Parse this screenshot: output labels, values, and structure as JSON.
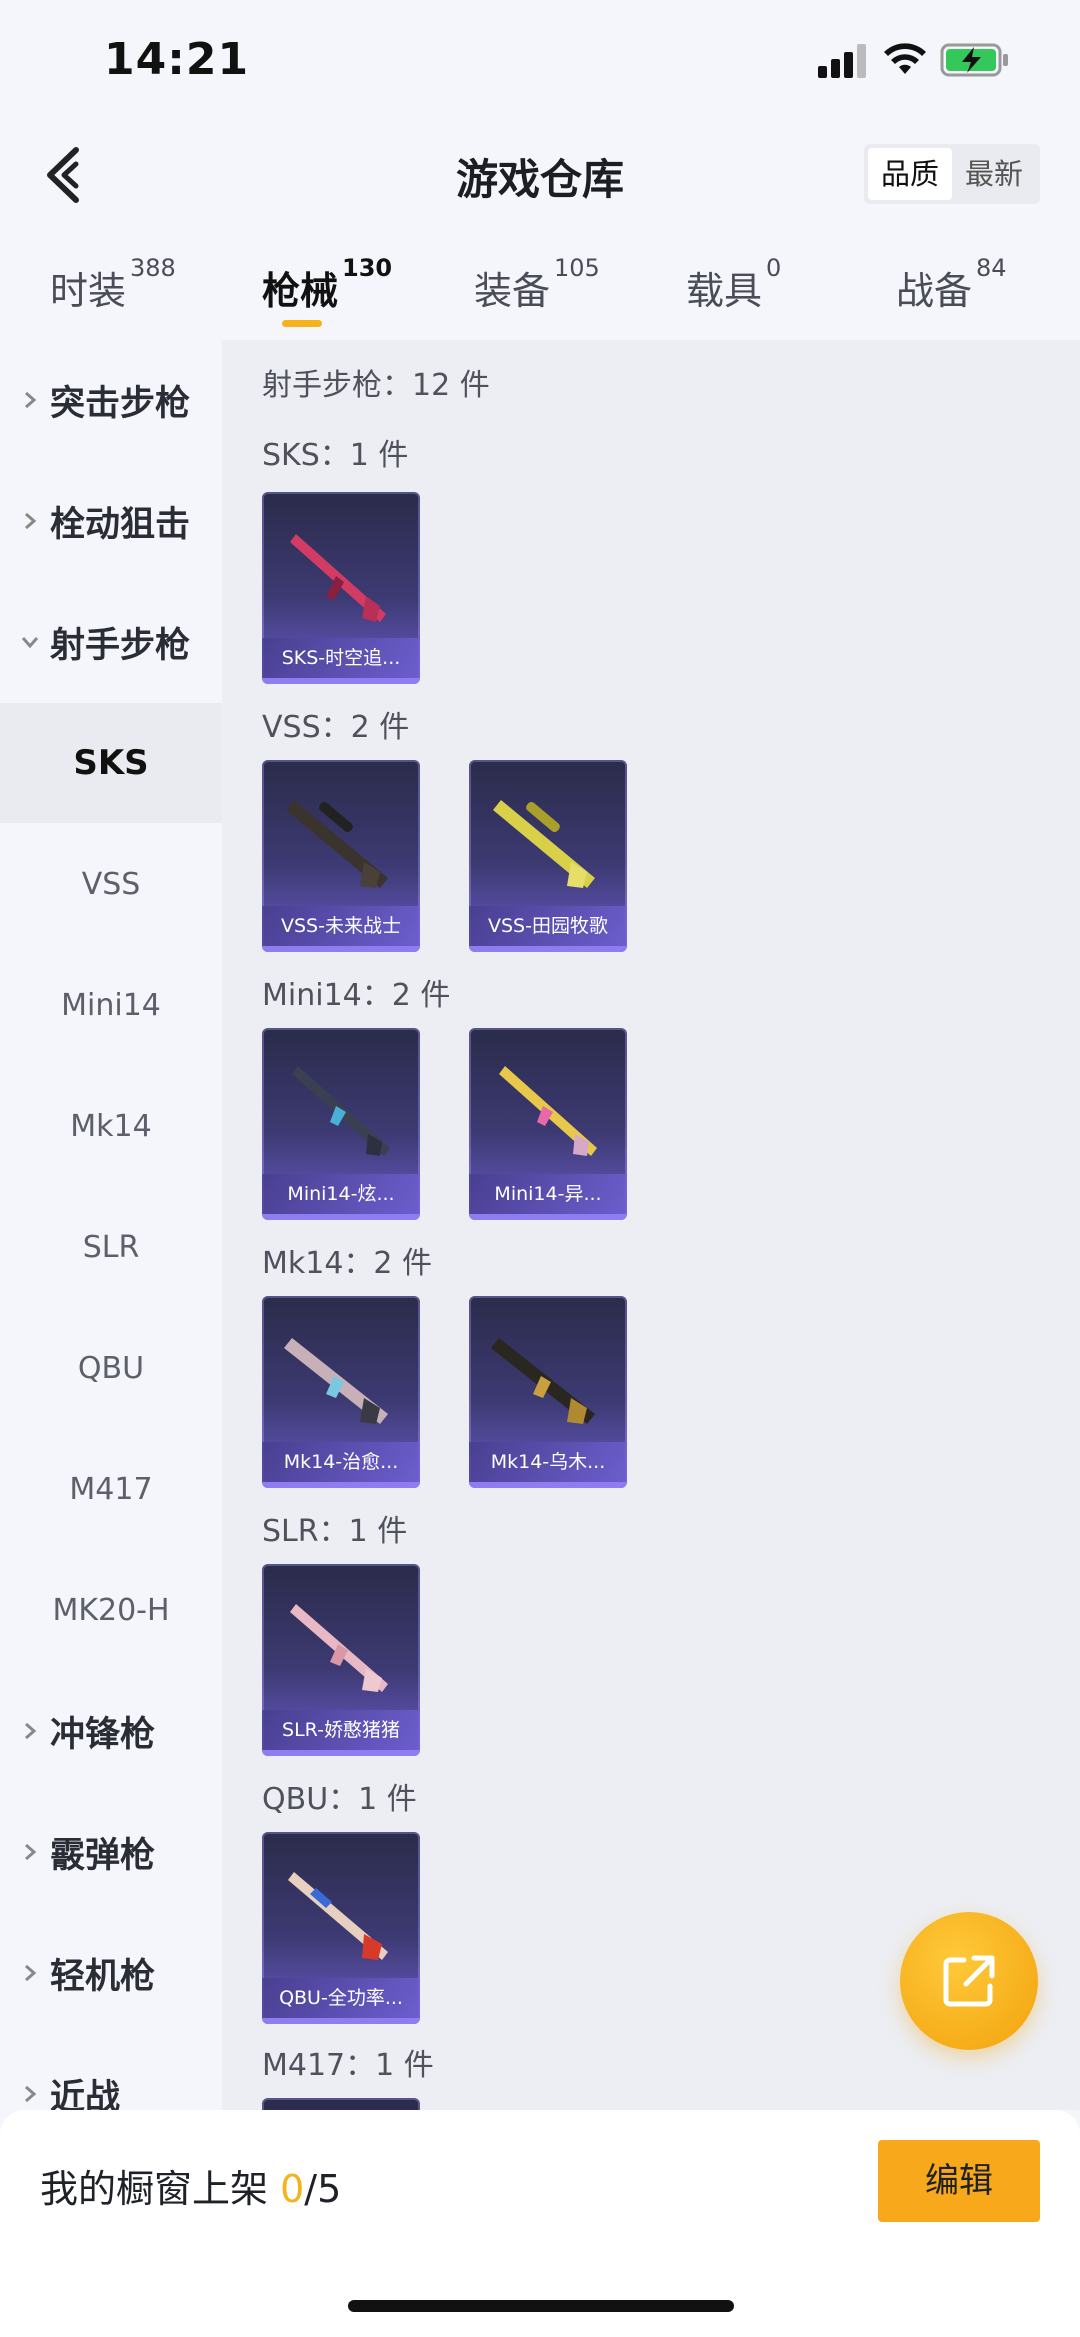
{
  "status_bar": {
    "time": "14:21"
  },
  "header": {
    "title": "游戏仓库",
    "sort_options": [
      "品质",
      "最新"
    ]
  },
  "tabs": [
    {
      "label": "时装",
      "count": "388"
    },
    {
      "label": "枪械",
      "count": "130"
    },
    {
      "label": "装备",
      "count": "105"
    },
    {
      "label": "载具",
      "count": "0"
    },
    {
      "label": "战备",
      "count": "84"
    }
  ],
  "sidebar": {
    "items": [
      {
        "label": "突击步枪"
      },
      {
        "label": "栓动狙击"
      },
      {
        "label": "射手步枪"
      },
      {
        "label": "SKS"
      },
      {
        "label": "VSS"
      },
      {
        "label": "Mini14"
      },
      {
        "label": "Mk14"
      },
      {
        "label": "SLR"
      },
      {
        "label": "QBU"
      },
      {
        "label": "M417"
      },
      {
        "label": "MK20-H"
      },
      {
        "label": "冲锋枪"
      },
      {
        "label": "霰弹枪"
      },
      {
        "label": "轻机枪"
      },
      {
        "label": "近战"
      }
    ]
  },
  "main": {
    "section_title": "射手步枪：12 件",
    "groups": [
      {
        "label": "SKS：1 件",
        "cards": [
          {
            "name": "SKS-时空追..."
          }
        ]
      },
      {
        "label": "VSS：2 件",
        "cards": [
          {
            "name": "VSS-未来战士"
          },
          {
            "name": "VSS-田园牧歌"
          }
        ]
      },
      {
        "label": "Mini14：2 件",
        "cards": [
          {
            "name": "Mini14-炫..."
          },
          {
            "name": "Mini14-异..."
          }
        ]
      },
      {
        "label": "Mk14：2 件",
        "cards": [
          {
            "name": "Mk14-治愈..."
          },
          {
            "name": "Mk14-乌木..."
          }
        ]
      },
      {
        "label": "SLR：1 件",
        "cards": [
          {
            "name": "SLR-娇憨猪猪"
          }
        ]
      },
      {
        "label": "QBU：1 件",
        "cards": [
          {
            "name": "QBU-全功率..."
          }
        ]
      },
      {
        "label": "M417：1 件",
        "cards": []
      }
    ]
  },
  "bottom_bar": {
    "showcase_label": "我的橱窗上架",
    "showcase_current": "0",
    "showcase_total": "/5",
    "edit_label": "编辑"
  },
  "colors": {
    "accent": "#f5b21a",
    "fab": "#f7a81b",
    "card_bottom": "#6a5bc8"
  }
}
